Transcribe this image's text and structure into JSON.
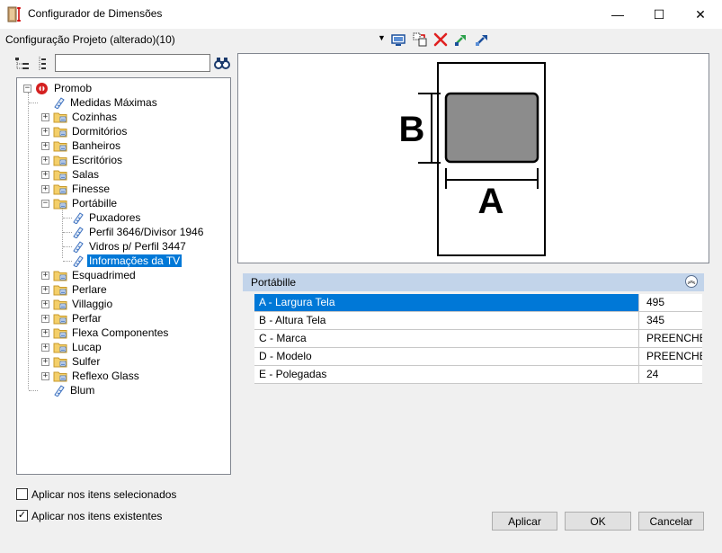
{
  "window": {
    "title": "Configurador de Dimensões",
    "minimize": "—",
    "maximize": "☐",
    "close": "✕"
  },
  "config": {
    "label": "Configuração Projeto (alterado)(10)",
    "dropdown": "▼"
  },
  "search": {
    "value": "",
    "placeholder": ""
  },
  "tree": {
    "root": "Promob",
    "items": [
      {
        "label": "Medidas Máximas"
      },
      {
        "label": "Cozinhas"
      },
      {
        "label": "Dormitórios"
      },
      {
        "label": "Banheiros"
      },
      {
        "label": "Escritórios"
      },
      {
        "label": "Salas"
      },
      {
        "label": "Finesse"
      },
      {
        "label": "Portábille"
      },
      {
        "label": "Puxadores"
      },
      {
        "label": "Perfil 3646/Divisor 1946"
      },
      {
        "label": "Vidros p/ Perfil 3447"
      },
      {
        "label": "Informações da TV"
      },
      {
        "label": "Esquadrimed"
      },
      {
        "label": "Perlare"
      },
      {
        "label": "Villaggio"
      },
      {
        "label": "Perfar"
      },
      {
        "label": "Flexa Componentes"
      },
      {
        "label": "Lucap"
      },
      {
        "label": "Sulfer"
      },
      {
        "label": "Reflexo Glass"
      },
      {
        "label": "Blum"
      }
    ]
  },
  "preview": {
    "label_a": "A",
    "label_b": "B"
  },
  "properties": {
    "group": "Portábille",
    "rows": [
      {
        "name": "A -  Largura Tela",
        "value": "495"
      },
      {
        "name": "B -  Altura Tela",
        "value": "345"
      },
      {
        "name": "C -  Marca",
        "value": "PREENCHER"
      },
      {
        "name": "D -  Modelo",
        "value": "PREENCHER"
      },
      {
        "name": "E -  Polegadas",
        "value": "24"
      }
    ]
  },
  "options": {
    "apply_selected": "Aplicar nos itens selecionados",
    "apply_existing": "Aplicar nos itens existentes"
  },
  "buttons": {
    "apply": "Aplicar",
    "ok": "OK",
    "cancel": "Cancelar"
  },
  "colors": {
    "accent": "#0078d7",
    "group_header": "#c2d4ea",
    "screen_fill": "#8c8c8c"
  }
}
